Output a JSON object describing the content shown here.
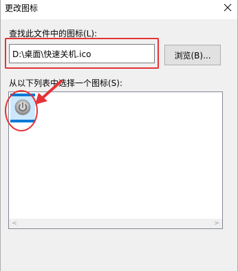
{
  "window": {
    "title": "更改图标",
    "close_glyph": "✕"
  },
  "path_section": {
    "label": "查找此文件中的图标(L):",
    "value": "D:\\桌面\\快速关机.ico",
    "browse_label": "浏览(B)..."
  },
  "icons_section": {
    "label": "从以下列表中选择一个图标(S):",
    "items": [
      {
        "icon": "power-icon",
        "selected": true
      }
    ],
    "scroll_left_glyph": "<",
    "scroll_right_glyph": ">"
  },
  "annotations": {
    "highlight_color": "#e53236"
  }
}
